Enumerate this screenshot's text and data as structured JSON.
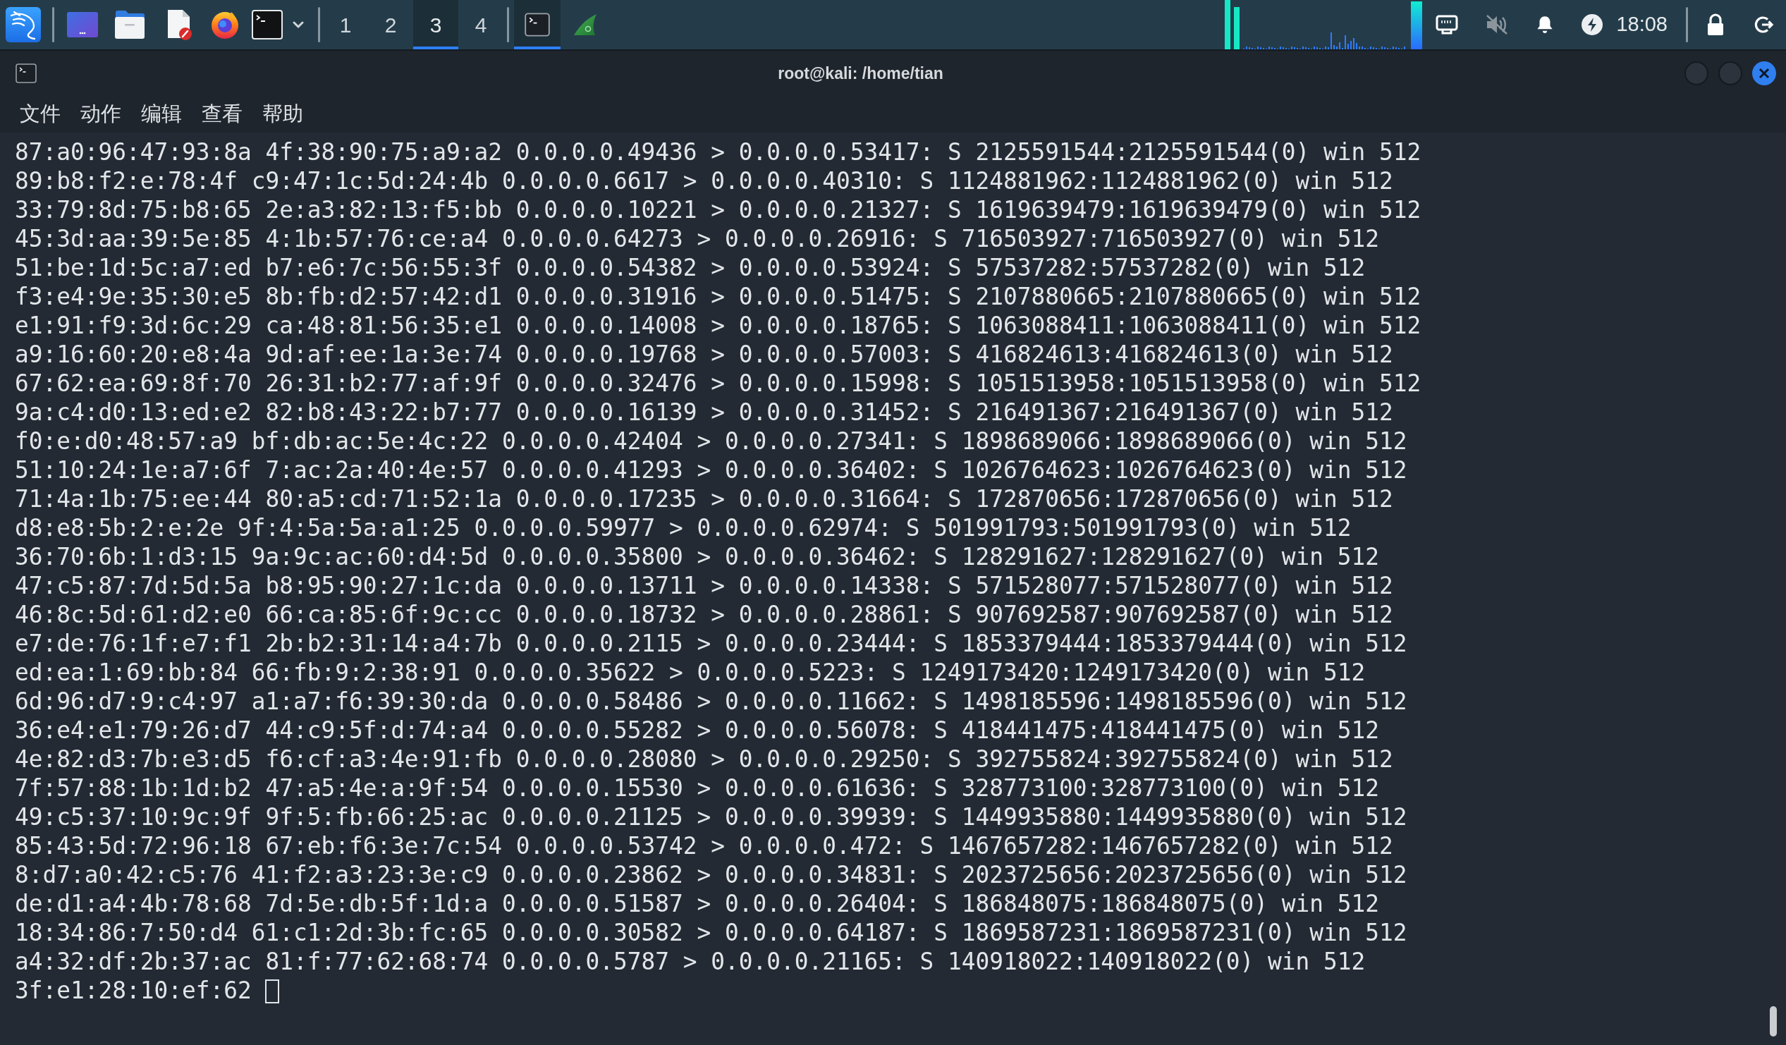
{
  "taskbar": {
    "workspaces": [
      {
        "label": "1",
        "selected": false
      },
      {
        "label": "2",
        "selected": false
      },
      {
        "label": "3",
        "selected": true
      },
      {
        "label": "4",
        "selected": false
      }
    ],
    "tasks": [
      {
        "kind": "terminal",
        "selected": true
      },
      {
        "kind": "shark",
        "selected": false
      }
    ],
    "volume": {
      "muted": true
    },
    "clock": "18:08"
  },
  "window": {
    "title": "root@kali: /home/tian",
    "menu": [
      "文件",
      "动作",
      "编辑",
      "查看",
      "帮助"
    ]
  },
  "terminal": {
    "lines": [
      "87:a0:96:47:93:8a 4f:38:90:75:a9:a2 0.0.0.0.49436 > 0.0.0.0.53417: S 2125591544:2125591544(0) win 512",
      "89:b8:f2:e:78:4f c9:47:1c:5d:24:4b 0.0.0.0.6617 > 0.0.0.0.40310: S 1124881962:1124881962(0) win 512",
      "33:79:8d:75:b8:65 2e:a3:82:13:f5:bb 0.0.0.0.10221 > 0.0.0.0.21327: S 1619639479:1619639479(0) win 512",
      "45:3d:aa:39:5e:85 4:1b:57:76:ce:a4 0.0.0.0.64273 > 0.0.0.0.26916: S 716503927:716503927(0) win 512",
      "51:be:1d:5c:a7:ed b7:e6:7c:56:55:3f 0.0.0.0.54382 > 0.0.0.0.53924: S 57537282:57537282(0) win 512",
      "f3:e4:9e:35:30:e5 8b:fb:d2:57:42:d1 0.0.0.0.31916 > 0.0.0.0.51475: S 2107880665:2107880665(0) win 512",
      "e1:91:f9:3d:6c:29 ca:48:81:56:35:e1 0.0.0.0.14008 > 0.0.0.0.18765: S 1063088411:1063088411(0) win 512",
      "a9:16:60:20:e8:4a 9d:af:ee:1a:3e:74 0.0.0.0.19768 > 0.0.0.0.57003: S 416824613:416824613(0) win 512",
      "67:62:ea:69:8f:70 26:31:b2:77:af:9f 0.0.0.0.32476 > 0.0.0.0.15998: S 1051513958:1051513958(0) win 512",
      "9a:c4:d0:13:ed:e2 82:b8:43:22:b7:77 0.0.0.0.16139 > 0.0.0.0.31452: S 216491367:216491367(0) win 512",
      "f0:e:d0:48:57:a9 bf:db:ac:5e:4c:22 0.0.0.0.42404 > 0.0.0.0.27341: S 1898689066:1898689066(0) win 512",
      "51:10:24:1e:a7:6f 7:ac:2a:40:4e:57 0.0.0.0.41293 > 0.0.0.0.36402: S 1026764623:1026764623(0) win 512",
      "71:4a:1b:75:ee:44 80:a5:cd:71:52:1a 0.0.0.0.17235 > 0.0.0.0.31664: S 172870656:172870656(0) win 512",
      "d8:e8:5b:2:e:2e 9f:4:5a:5a:a1:25 0.0.0.0.59977 > 0.0.0.0.62974: S 501991793:501991793(0) win 512",
      "36:70:6b:1:d3:15 9a:9c:ac:60:d4:5d 0.0.0.0.35800 > 0.0.0.0.36462: S 128291627:128291627(0) win 512",
      "47:c5:87:7d:5d:5a b8:95:90:27:1c:da 0.0.0.0.13711 > 0.0.0.0.14338: S 571528077:571528077(0) win 512",
      "46:8c:5d:61:d2:e0 66:ca:85:6f:9c:cc 0.0.0.0.18732 > 0.0.0.0.28861: S 907692587:907692587(0) win 512",
      "e7:de:76:1f:e7:f1 2b:b2:31:14:a4:7b 0.0.0.0.2115 > 0.0.0.0.23444: S 1853379444:1853379444(0) win 512",
      "ed:ea:1:69:bb:84 66:fb:9:2:38:91 0.0.0.0.35622 > 0.0.0.0.5223: S 1249173420:1249173420(0) win 512",
      "6d:96:d7:9:c4:97 a1:a7:f6:39:30:da 0.0.0.0.58486 > 0.0.0.0.11662: S 1498185596:1498185596(0) win 512",
      "36:e4:e1:79:26:d7 44:c9:5f:d:74:a4 0.0.0.0.55282 > 0.0.0.0.56078: S 418441475:418441475(0) win 512",
      "4e:82:d3:7b:e3:d5 f6:cf:a3:4e:91:fb 0.0.0.0.28080 > 0.0.0.0.29250: S 392755824:392755824(0) win 512",
      "7f:57:88:1b:1d:b2 47:a5:4e:a:9f:54 0.0.0.0.15530 > 0.0.0.0.61636: S 328773100:328773100(0) win 512",
      "49:c5:37:10:9c:9f 9f:5:fb:66:25:ac 0.0.0.0.21125 > 0.0.0.0.39939: S 1449935880:1449935880(0) win 512",
      "85:43:5d:72:96:18 67:eb:f6:3e:7c:54 0.0.0.0.53742 > 0.0.0.0.472: S 1467657282:1467657282(0) win 512",
      "8:d7:a0:42:c5:76 41:f2:a3:23:3e:c9 0.0.0.0.23862 > 0.0.0.0.34831: S 2023725656:2023725656(0) win 512",
      "de:d1:a4:4b:78:68 7d:5e:db:5f:1d:a 0.0.0.0.51587 > 0.0.0.0.26404: S 186848075:186848075(0) win 512",
      "18:34:86:7:50:d4 61:c1:2d:3b:fc:65 0.0.0.0.30582 > 0.0.0.0.64187: S 1869587231:1869587231(0) win 512",
      "a4:32:df:2b:37:ac 81:f:77:62:68:74 0.0.0.0.5787 > 0.0.0.0.21165: S 140918022:140918022(0) win 512"
    ],
    "input": "3f:e1:28:10:ef:62"
  }
}
